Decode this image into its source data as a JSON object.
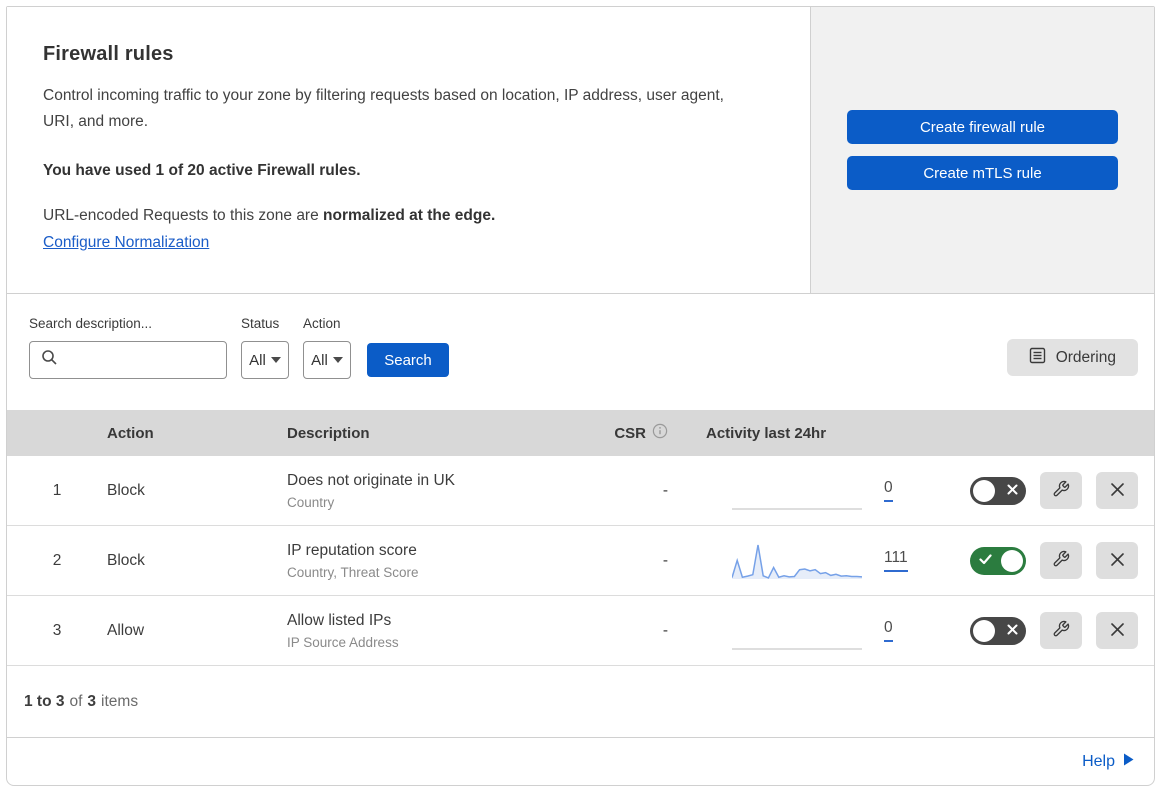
{
  "header": {
    "title": "Firewall rules",
    "description": "Control incoming traffic to your zone by filtering requests based on location, IP address, user agent, URI, and more.",
    "usage_note": "You have used 1 of 20 active Firewall rules.",
    "normalization_prefix": "URL-encoded Requests to this zone are ",
    "normalization_bold": "normalized at the edge.",
    "normalization_link": "Configure Normalization",
    "buttons": {
      "create_firewall": "Create firewall rule",
      "create_mtls": "Create mTLS rule"
    }
  },
  "filters": {
    "search_label": "Search description...",
    "status_label": "Status",
    "status_value": "All",
    "action_label": "Action",
    "action_value": "All",
    "search_button": "Search",
    "ordering_button": "Ordering"
  },
  "table": {
    "columns": {
      "action": "Action",
      "description": "Description",
      "csr": "CSR",
      "activity": "Activity last 24hr"
    },
    "rows": [
      {
        "index": "1",
        "action": "Block",
        "title": "Does not originate in UK",
        "subtitle": "Country",
        "csr": "-",
        "count": "0",
        "enabled": false,
        "sparkline": []
      },
      {
        "index": "2",
        "action": "Block",
        "title": "IP reputation score",
        "subtitle": "Country, Threat Score",
        "csr": "-",
        "count": "111",
        "enabled": true,
        "sparkline": [
          4,
          52,
          5,
          8,
          12,
          95,
          9,
          3,
          32,
          5,
          9,
          6,
          7,
          26,
          28,
          23,
          26,
          15,
          18,
          10,
          13,
          8,
          9,
          7,
          7,
          6
        ]
      },
      {
        "index": "3",
        "action": "Allow",
        "title": "Allow listed IPs",
        "subtitle": "IP Source Address",
        "csr": "-",
        "count": "0",
        "enabled": false,
        "sparkline": []
      }
    ]
  },
  "footer": {
    "range_bold": "1 to 3",
    "of_text": "of",
    "total_bold": "3",
    "items_text": "items",
    "help": "Help"
  },
  "colors": {
    "accent_blue": "#0b5cc7",
    "toggle_on_green": "#2b7c3f",
    "toggle_off_gray": "#474747",
    "sparkline_blue": "#76a1e8",
    "header_gray": "#d8d8d8",
    "panel_gray": "#f1f1f1"
  }
}
